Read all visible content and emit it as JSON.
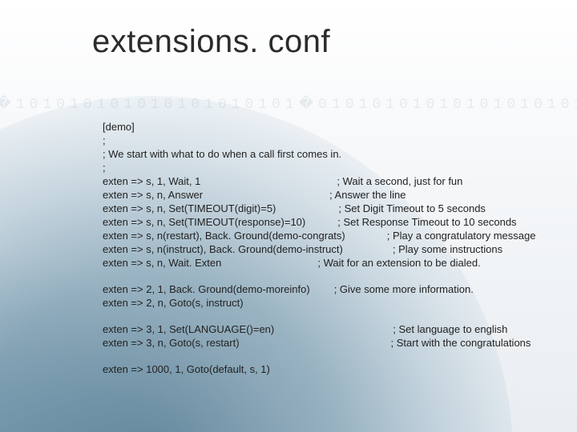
{
  "title": "extensions. conf",
  "section": "[demo]",
  "comment_lines": [
    ";",
    "; We start with what to do when a call first comes in.",
    ";"
  ],
  "block1": [
    {
      "lhs": "exten => s, 1, Wait, 1",
      "rhs": "; Wait a second, just for fun"
    },
    {
      "lhs": "exten => s, n, Answer",
      "rhs": "; Answer the line"
    },
    {
      "lhs": "exten => s, n, Set(TIMEOUT(digit)=5)",
      "rhs": "; Set Digit Timeout to 5 seconds"
    },
    {
      "lhs": "exten => s, n, Set(TIMEOUT(response)=10)",
      "rhs": "; Set Response Timeout to 10 seconds"
    },
    {
      "lhs": "exten => s, n(restart), Back. Ground(demo-congrats)",
      "rhs": "; Play a congratulatory message"
    },
    {
      "lhs": "exten => s, n(instruct), Back. Ground(demo-instruct)",
      "rhs": "; Play some instructions"
    },
    {
      "lhs": "exten => s, n, Wait. Exten",
      "rhs": "; Wait for an extension to be dialed."
    }
  ],
  "block2": [
    {
      "lhs": "exten => 2, 1, Back. Ground(demo-moreinfo)",
      "rhs": "; Give some more information."
    },
    {
      "lhs": "exten => 2, n, Goto(s, instruct)",
      "rhs": ""
    }
  ],
  "block3": [
    {
      "lhs": "exten => 3, 1, Set(LANGUAGE()=en)",
      "rhs": "; Set language to english"
    },
    {
      "lhs": "exten => 3, n, Goto(s, restart)",
      "rhs": "; Start with the congratulations"
    }
  ],
  "block4": [
    {
      "lhs": "exten => 1000, 1, Goto(default, s, 1)",
      "rhs": ""
    }
  ]
}
